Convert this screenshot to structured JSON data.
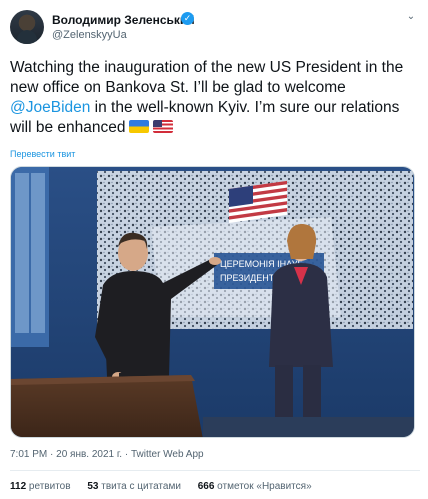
{
  "tweet": {
    "author_name": "Володимир Зеленський",
    "handle": "@ZelenskyyUa",
    "body": {
      "part1": "Watching the inauguration of the new US President in the new office on Bankova St. I’ll be glad to welcome ",
      "mention": "@JoeBiden",
      "part2": " in the well-known Kyiv. I’m sure our relations will be enhanced"
    },
    "translate_link": "Перевести твит",
    "photo_tv_caption_line1": "ЦЕРЕМОНІЯ ІНАУГ",
    "photo_tv_caption_line2": "ПРЕЗИДЕНТА",
    "timestamp": "7:01 PM · 20 янв. 2021 г. · Twitter Web App",
    "stats": {
      "retweets_count": "112",
      "retweets_label": "ретвитов",
      "quotes_count": "53",
      "quotes_label": "твита с цитатами",
      "likes_count": "666",
      "likes_label": "отметок «Нравится»"
    },
    "icons": {
      "verified": "verified-badge-icon",
      "more": "chevron-down-icon",
      "flag_ua": "ukraine-flag-emoji",
      "flag_us": "us-flag-emoji"
    },
    "colors": {
      "link": "#1b95e0",
      "verified": "#1d9bf0",
      "muted": "#536471"
    }
  }
}
